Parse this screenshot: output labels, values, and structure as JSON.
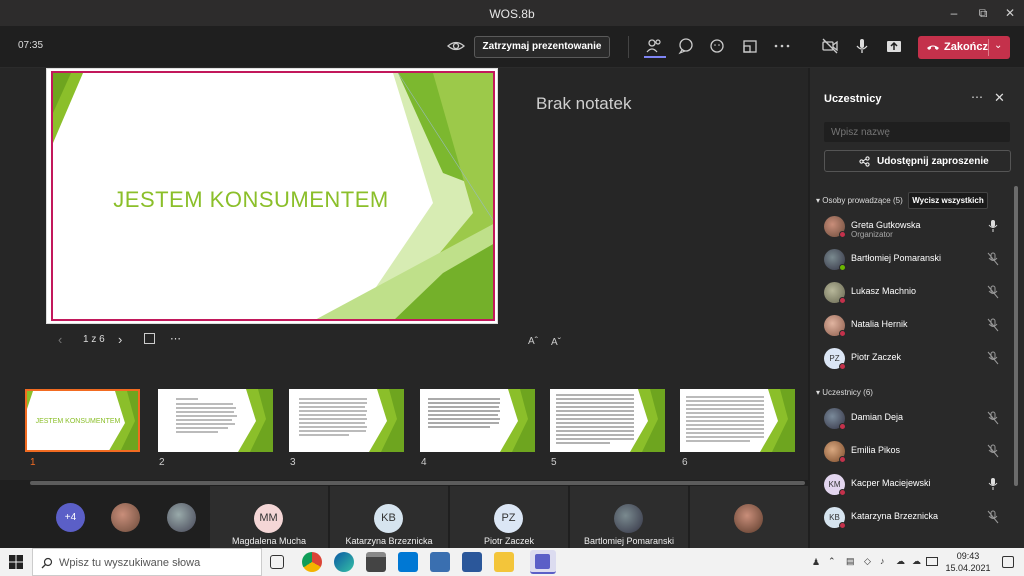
{
  "window": {
    "title": "WOS.8b",
    "min_icon": "minimize-icon",
    "max_icon": "maximize-icon",
    "close_icon": "close-icon"
  },
  "toolbar": {
    "timer": "07:35",
    "stop_presenting_label": "Zatrzymaj prezentowanie",
    "end_label": "Zakończ",
    "icons": [
      "eye-icon",
      "participants-icon",
      "chat-icon",
      "reactions-icon",
      "rooms-icon",
      "more-icon",
      "camera-off-icon",
      "mic-icon",
      "share-icon",
      "phone-hangup-icon",
      "chevron-down-icon"
    ]
  },
  "presentation": {
    "slide_title": "JESTEM KONSUMENTEM",
    "notes_placeholder": "Brak notatek",
    "page_indicator": "1 z 6",
    "slide_numbers": [
      "1",
      "2",
      "3",
      "4",
      "5",
      "6"
    ],
    "accent_color": "#8bbf2a",
    "border_color": "#c2185b"
  },
  "callbar": {
    "overflow_count": "+4",
    "tiles": [
      {
        "initials": "MM",
        "name": "Magdalena Mucha",
        "color": "#f4d6d6"
      },
      {
        "initials": "KB",
        "name": "Katarzyna Brzeznicka",
        "color": "#d6e4ef"
      },
      {
        "initials": "PZ",
        "name": "Piotr Zaczek",
        "color": "#dbe6f5"
      },
      {
        "initials": "",
        "name": "Bartlomiej Pomaranski",
        "color": "#556"
      },
      {
        "initials": "",
        "name": "",
        "color": "#6a4a3a"
      }
    ]
  },
  "panel": {
    "title": "Uczestnicy",
    "search_placeholder": "Wpisz nazwę",
    "share_invite_label": "Udostępnij zaproszenie",
    "presenters_header": "Osoby prowadzące (5)",
    "clear_all_label": "Wycisz wszystkich",
    "attendees_header": "Uczestnicy (6)",
    "presenters": [
      {
        "name": "Greta Gutkowska",
        "role": "Organizator",
        "initials": "",
        "avatar_color": "#8a6a5a",
        "status_color": "#c4314b",
        "mic": "mic-icon"
      },
      {
        "name": "Bartłomiej Pomaranski",
        "role": "",
        "initials": "",
        "avatar_color": "#556b73",
        "status_color": "#6bb700",
        "mic": "mic-off-icon"
      },
      {
        "name": "Lukasz Machnio",
        "role": "",
        "initials": "",
        "avatar_color": "#8f8f7a",
        "status_color": "#c4314b",
        "mic": "mic-off-icon"
      },
      {
        "name": "Natalia Hernik",
        "role": "",
        "initials": "",
        "avatar_color": "#c98e7a",
        "status_color": "#c4314b",
        "mic": "mic-off-icon"
      },
      {
        "name": "Piotr Zaczek",
        "role": "",
        "initials": "PZ",
        "avatar_color": "#dbe6f5",
        "status_color": "#c4314b",
        "mic": "mic-off-icon"
      }
    ],
    "attendees": [
      {
        "name": "Damian Deja",
        "initials": "",
        "avatar_color": "#4a5a6a",
        "status_color": "#c4314b",
        "mic": "mic-off-icon"
      },
      {
        "name": "Emilia Pikos",
        "initials": "",
        "avatar_color": "#a67a5a",
        "status_color": "#c4314b",
        "mic": "mic-off-icon"
      },
      {
        "name": "Kacper Maciejewski",
        "initials": "KM",
        "avatar_color": "#e3d6ef",
        "status_color": "#c4314b",
        "mic": "mic-icon"
      },
      {
        "name": "Katarzyna Brzeznicka",
        "initials": "KB",
        "avatar_color": "#d6e4ef",
        "status_color": "#c4314b",
        "mic": "mic-off-icon"
      }
    ]
  },
  "taskbar": {
    "search_placeholder": "Wpisz tu wyszukiwane słowa",
    "time": "09:43",
    "date": "15.04.2021",
    "apps": [
      "task-view-icon",
      "chrome-icon",
      "edge-icon",
      "store-icon",
      "mail-icon",
      "calculator-icon",
      "word-icon",
      "explorer-icon",
      "teams-icon"
    ]
  }
}
